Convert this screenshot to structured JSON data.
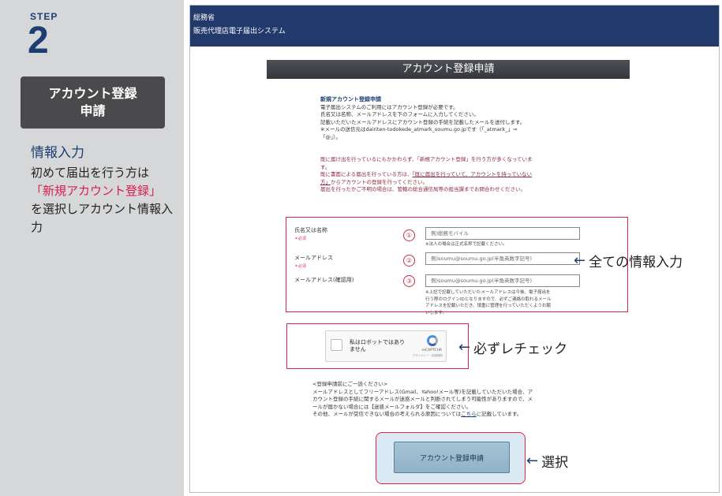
{
  "guide": {
    "step_label": "STEP",
    "step_number": "2",
    "box_title": "アカウント登録申請",
    "section_title": "情報入力",
    "body_before": "初めて届出を行う方は",
    "body_red": "「新規アカウント登録」",
    "body_after": "を選択しアカウント情報入力"
  },
  "header": {
    "ministry": "総務省",
    "system": "販売代理店電子届出システム"
  },
  "page_title": "アカウント登録申請",
  "intro": {
    "heading": "新規アカウント登録申請",
    "lines": [
      "電子届出システムのご利用にはアカウント登録が必要です。",
      "氏名又は名称、メールアドレスを下のフォームに入力してください。",
      "記載いただいたメールアドレスにアカウント登録の手続を記載したメールを送付します。",
      "※メールの送信元はdairiten-todokede_atmark_soumu.go.jpです（「_atmark_」⇒",
      "「@」）。"
    ]
  },
  "warning": {
    "line1": "既に届け出を行っているにもかかわらず、「新規アカウント登録」を行う方が多くなっていま",
    "line2": "す。",
    "line3_pre": "既に書面による届出を行っている方は、",
    "line3_link": "「既に届出を行っていて、アカウントを持っていない",
    "line4_link": "方」",
    "line4_post": "からアカウントの登録を行ってください。",
    "line5": "届出を行ったかご不明の場合は、管轄の総合通信局等の担当課までお問合わせください。"
  },
  "form": {
    "name_label": "氏名又は名称",
    "name_required": "＊必須",
    "name_num": "①",
    "name_placeholder": "例)総務モバイル",
    "name_note": "※法人の場合は正式名称で記載ください。",
    "email_label": "メールアドレス",
    "email_required": "＊必須",
    "email_num": "②",
    "email_placeholder": "例)soumu@soumu.go.jp(半角英数字記号)",
    "confirm_label": "メールアドレス(確認用)",
    "confirm_num": "③",
    "confirm_placeholder": "例)soumu@soumu.go.jp(半角英数字記号)",
    "confirm_note_1": "※上記で記載していただいたメールアドレスは今後、電子届出を",
    "confirm_note_2": "行う際のログインIDとなりますので、必ずご連絡の取れるメール",
    "confirm_note_3": "アドレスを記載いただき、慎重に管理を行っていただくようお願",
    "confirm_note_4": "いします。"
  },
  "captcha": {
    "label": "私はロボットではありません",
    "brand": "reCAPTCHA",
    "terms": "プライバシー・利用規約"
  },
  "annotations": {
    "all_info": "全ての情報入力",
    "check": "必ずレチェック",
    "select": "選択"
  },
  "notice": {
    "title": "<登録申請前にご一読ください>",
    "line1": "メールアドレスとしてフリーアドレス(Gmail、Yahoo!メール等)を記載していただいた場合、ア",
    "line2": "カウント登録の手続に関するメールが迷惑メールと判断されてしまう可能性がありますので、メ",
    "line3": "ールが届かない場合には【迷惑メールフォルダ】をご確認ください。",
    "line4_pre": "その他、メールが受信できない場合の考えられる原因については",
    "line4_link": "こちら",
    "line4_post": "に記載しています。"
  },
  "submit_label": "アカウント登録申請",
  "colors": {
    "navy": "#213a6b",
    "highlight_red": "#d8274f",
    "panel_gray": "#d6d7d8"
  }
}
